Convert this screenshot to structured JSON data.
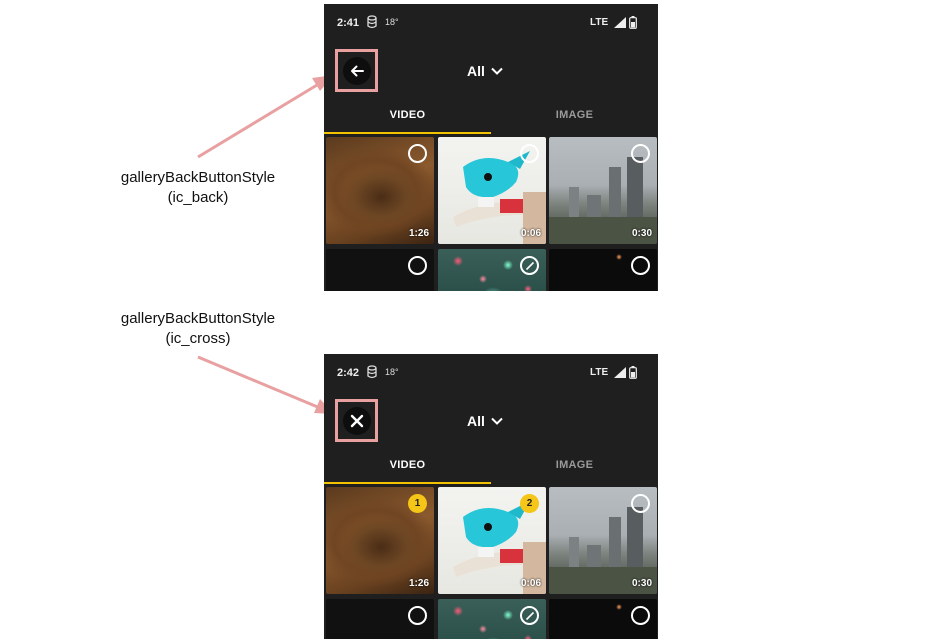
{
  "annotations": [
    {
      "style_name": "galleryBackButtonStyle",
      "icon_ref": "(ic_back)"
    },
    {
      "style_name": "galleryBackButtonStyle",
      "icon_ref": "(ic_cross)"
    }
  ],
  "screens": [
    {
      "status": {
        "time": "2:41",
        "temp": "18°",
        "network": "LTE"
      },
      "back_icon": "back-arrow-icon",
      "dropdown_label": "All",
      "tabs": [
        {
          "label": "VIDEO",
          "active": true
        },
        {
          "label": "IMAGE",
          "active": false
        }
      ],
      "tiles": [
        {
          "thumb": "desert",
          "selector": "empty",
          "duration": "1:26"
        },
        {
          "thumb": "figurine",
          "selector": "empty",
          "duration": "0:06"
        },
        {
          "thumb": "city",
          "selector": "empty",
          "duration": "0:30"
        },
        {
          "thumb": "dark",
          "selector": "empty",
          "duration": ""
        },
        {
          "thumb": "lights",
          "selector": "edit",
          "duration": ""
        },
        {
          "thumb": "dark-spark",
          "selector": "empty",
          "duration": ""
        }
      ]
    },
    {
      "status": {
        "time": "2:42",
        "temp": "18°",
        "network": "LTE"
      },
      "back_icon": "cross-icon",
      "dropdown_label": "All",
      "tabs": [
        {
          "label": "VIDEO",
          "active": true
        },
        {
          "label": "IMAGE",
          "active": false
        }
      ],
      "tiles": [
        {
          "thumb": "desert",
          "selector": "badge",
          "badge": "1",
          "duration": "1:26"
        },
        {
          "thumb": "figurine",
          "selector": "badge",
          "badge": "2",
          "duration": "0:06"
        },
        {
          "thumb": "city",
          "selector": "empty",
          "duration": "0:30"
        },
        {
          "thumb": "dark",
          "selector": "empty",
          "duration": ""
        },
        {
          "thumb": "lights",
          "selector": "edit",
          "duration": ""
        },
        {
          "thumb": "dark-spark",
          "selector": "empty",
          "duration": ""
        }
      ]
    }
  ],
  "colors": {
    "accent": "#f2c200",
    "highlight_box": "#e8a0a0",
    "badge": "#f5c518",
    "phone_bg": "#1f1f1f"
  }
}
